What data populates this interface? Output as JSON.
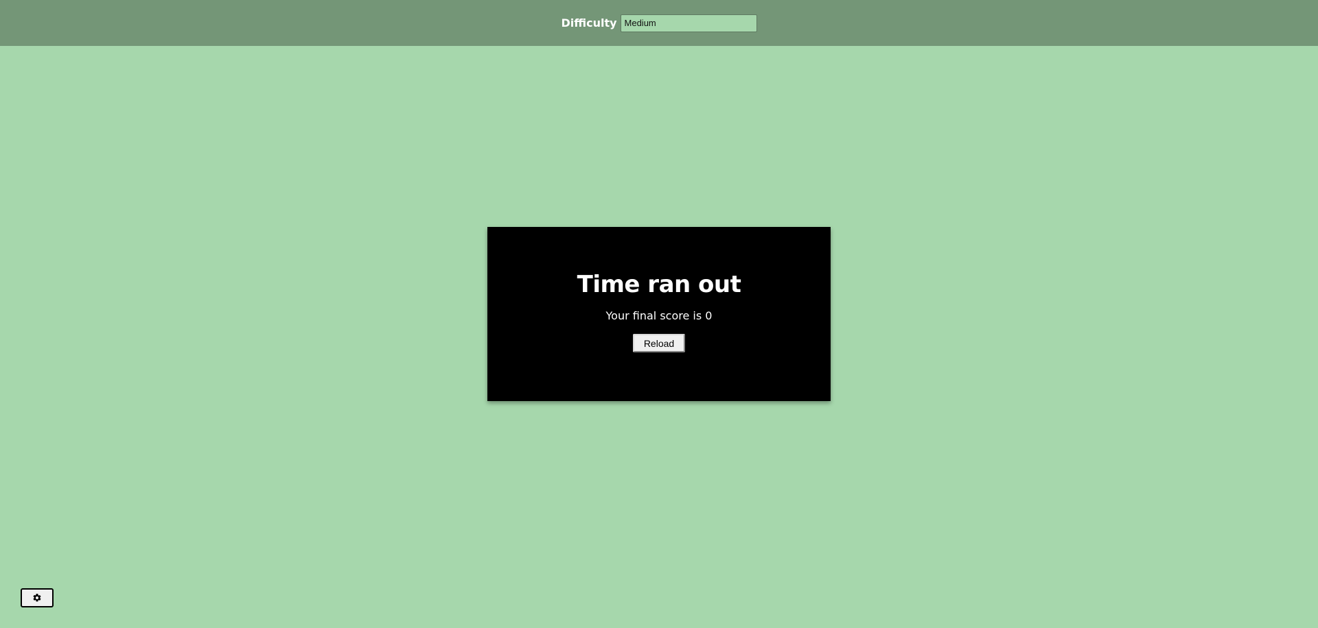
{
  "header": {
    "difficulty_label": "Difficulty",
    "difficulty_value": "Medium"
  },
  "modal": {
    "title": "Time ran out",
    "score_text": "Your final score is 0",
    "reload_label": "Reload"
  },
  "settings": {
    "icon": "gear-icon"
  },
  "colors": {
    "background": "#a6d7ac",
    "topbar": "#749677",
    "modal": "#000000",
    "modal_text": "#ffffff"
  }
}
